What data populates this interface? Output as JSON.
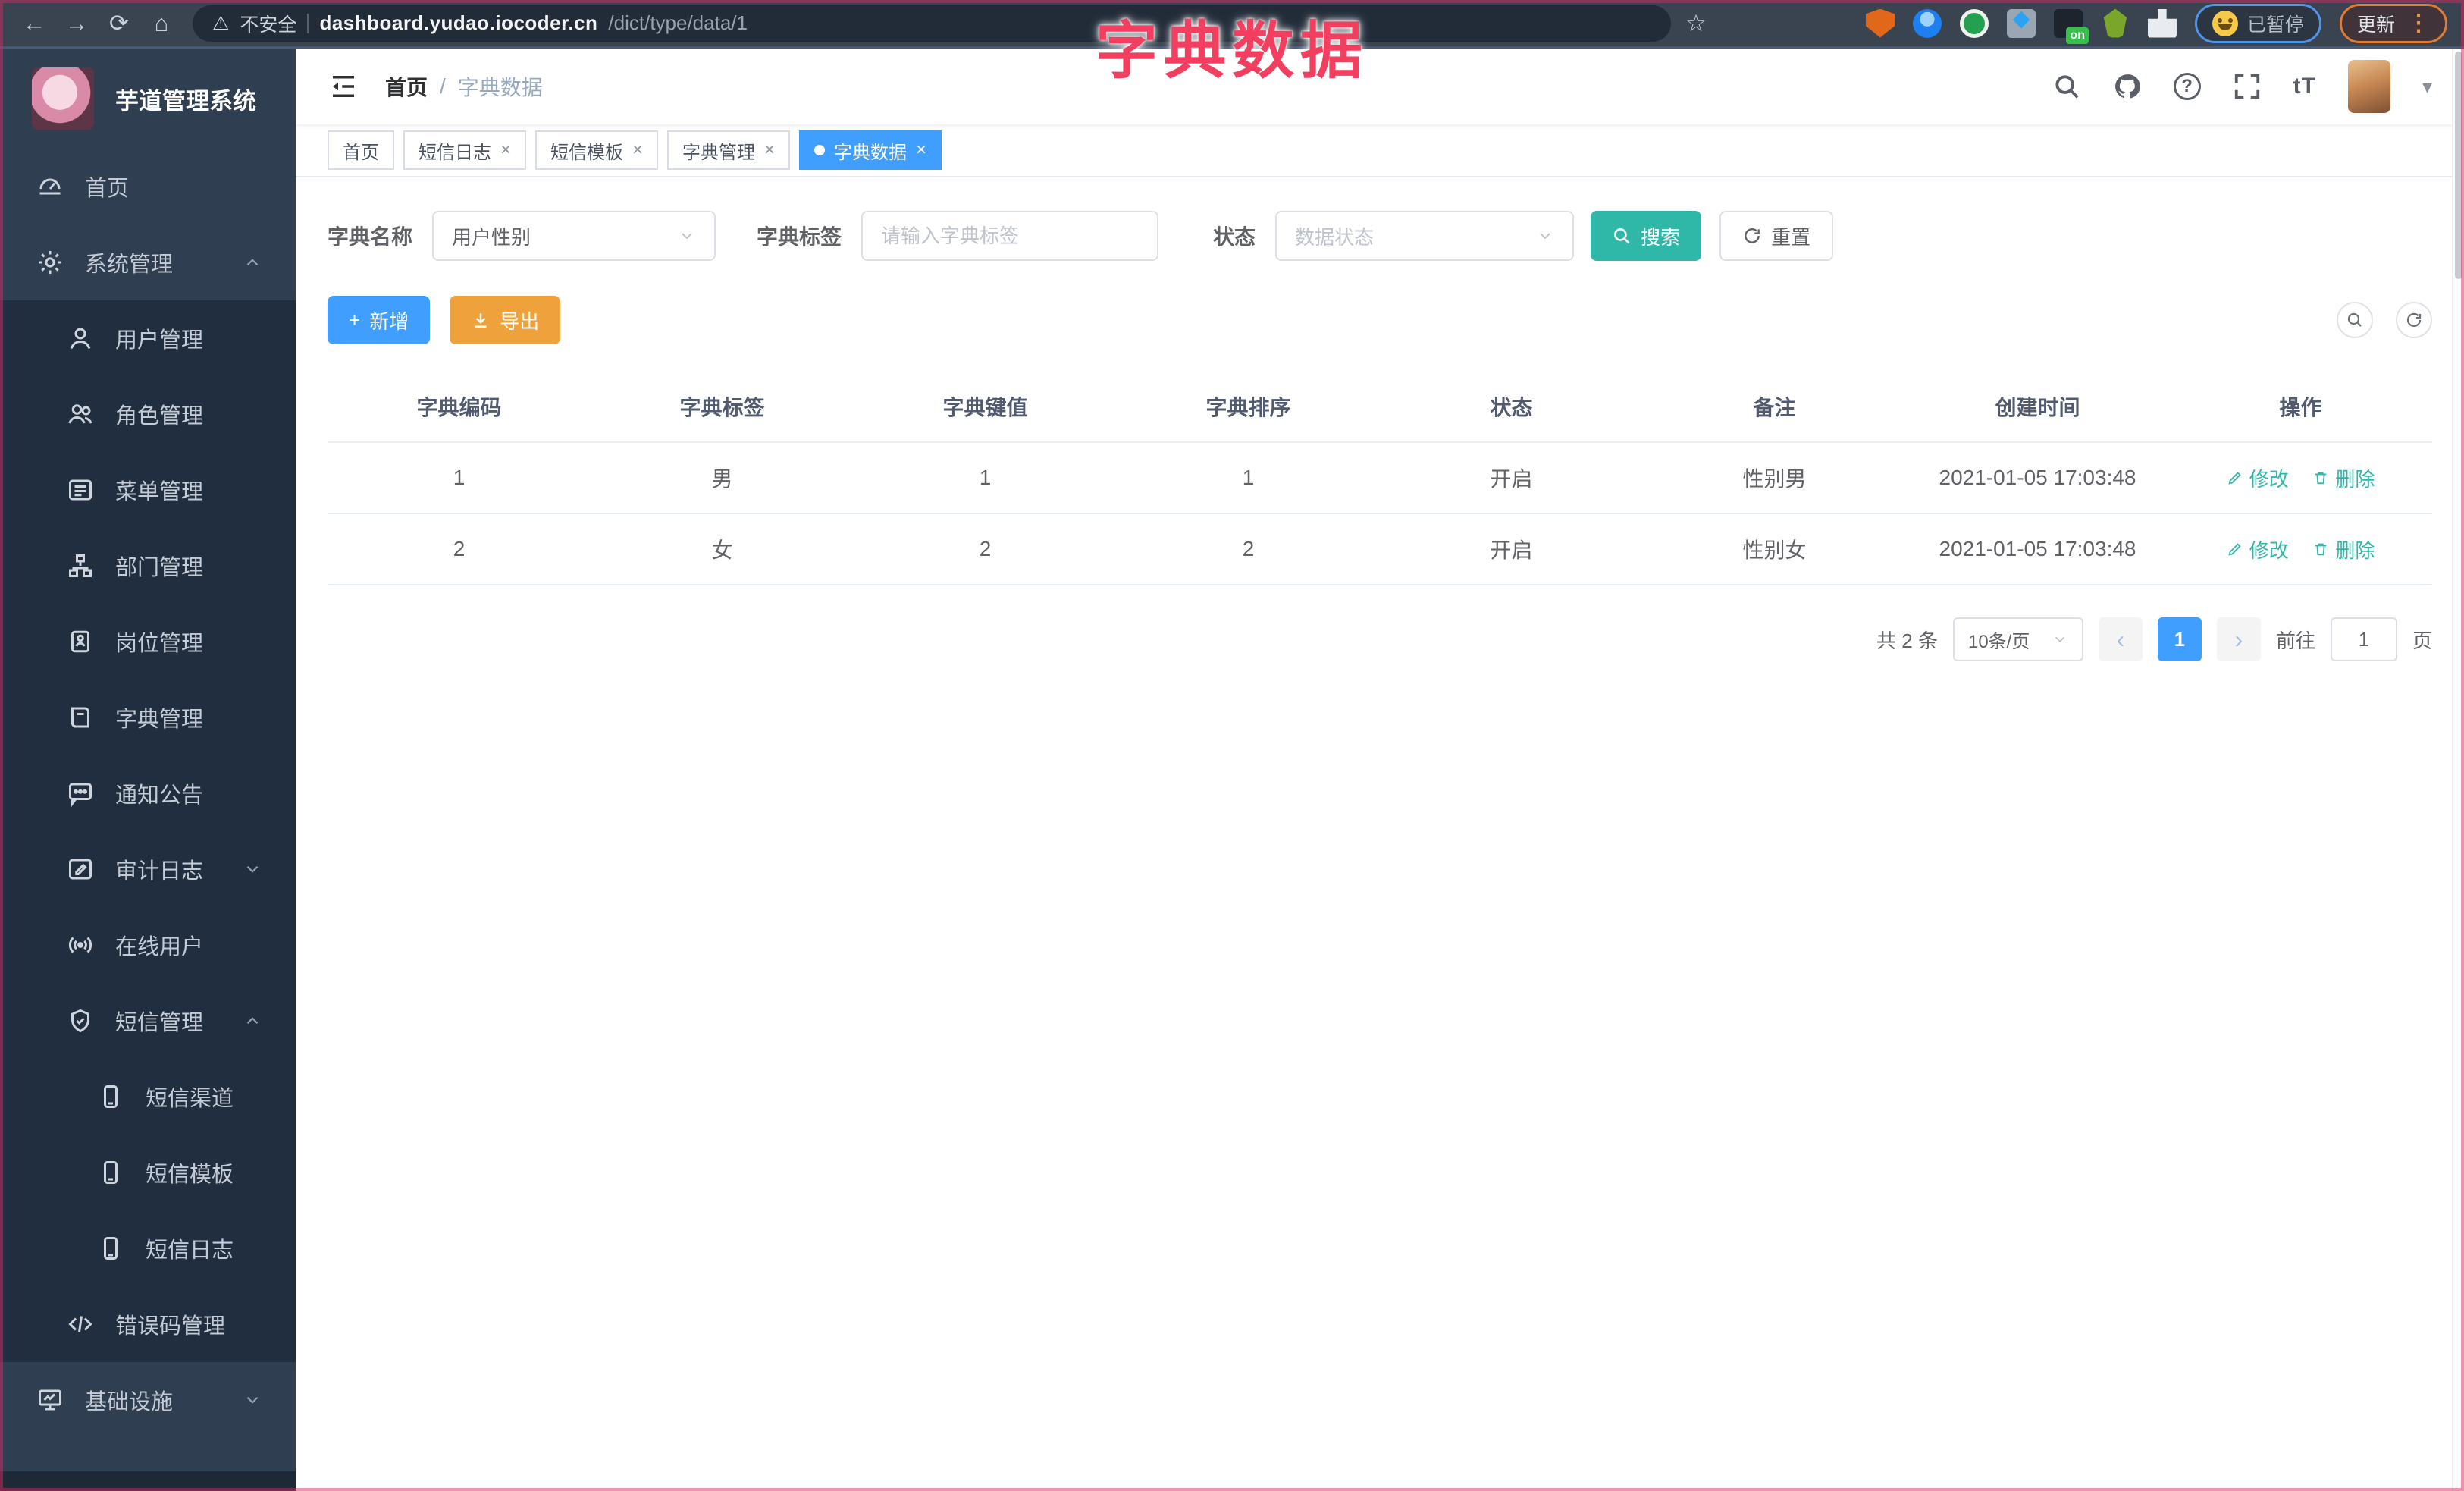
{
  "colors": {
    "primary": "#409eff",
    "teal": "#2fb8a8",
    "warning": "#efa23b",
    "overlay_pink": "#f23e5f",
    "sidebar_bg": "#2f3e50",
    "sidebar_sub_bg": "#212e3f"
  },
  "icons": {
    "back": "←",
    "forward": "→",
    "reload": "⟳",
    "home": "⌂",
    "warning": "⚠",
    "star": "☆",
    "kebab": "⋮",
    "close": "×",
    "prev": "‹",
    "next": "›",
    "question": "?",
    "font_size": "tT",
    "nav_caret": "▾",
    "on_badge": "on",
    "plus": "+"
  },
  "browser": {
    "security_label": "不安全",
    "url_domain": "dashboard.yudao.iocoder.cn",
    "url_path": "/dict/type/data/1",
    "paused_label": "已暂停",
    "update_label": "更新"
  },
  "overlay_title": "字典数据",
  "sidebar": {
    "logo_title": "芋道管理系统",
    "items": [
      {
        "label": "首页"
      },
      {
        "label": "系统管理"
      },
      {
        "label": "用户管理"
      },
      {
        "label": "角色管理"
      },
      {
        "label": "菜单管理"
      },
      {
        "label": "部门管理"
      },
      {
        "label": "岗位管理"
      },
      {
        "label": "字典管理"
      },
      {
        "label": "通知公告"
      },
      {
        "label": "审计日志"
      },
      {
        "label": "在线用户"
      },
      {
        "label": "短信管理"
      },
      {
        "label": "短信渠道"
      },
      {
        "label": "短信模板"
      },
      {
        "label": "短信日志"
      },
      {
        "label": "错误码管理"
      },
      {
        "label": "基础设施"
      }
    ]
  },
  "header": {
    "breadcrumb_home": "首页",
    "breadcrumb_sep": "/",
    "breadcrumb_current": "字典数据"
  },
  "tags": {
    "items": [
      {
        "label": "首页"
      },
      {
        "label": "短信日志"
      },
      {
        "label": "短信模板"
      },
      {
        "label": "字典管理"
      },
      {
        "label": "字典数据"
      }
    ]
  },
  "filters": {
    "name_label": "字典名称",
    "name_value": "用户性别",
    "tag_label": "字典标签",
    "tag_placeholder": "请输入字典标签",
    "status_label": "状态",
    "status_placeholder": "数据状态",
    "search_label": "搜索",
    "reset_label": "重置"
  },
  "toolbar": {
    "add_label": "新增",
    "export_label": "导出"
  },
  "table": {
    "headers": [
      "字典编码",
      "字典标签",
      "字典键值",
      "字典排序",
      "状态",
      "备注",
      "创建时间",
      "操作"
    ],
    "edit_label": "修改",
    "delete_label": "删除",
    "rows": [
      {
        "code": "1",
        "label": "男",
        "value": "1",
        "sort": "1",
        "status": "开启",
        "remark": "性别男",
        "created": "2021-01-05 17:03:48"
      },
      {
        "code": "2",
        "label": "女",
        "value": "2",
        "sort": "2",
        "status": "开启",
        "remark": "性别女",
        "created": "2021-01-05 17:03:48"
      }
    ]
  },
  "pagination": {
    "total": "共 2 条",
    "page_size": "10条/页",
    "current": "1",
    "goto_label": "前往",
    "goto_value": "1",
    "page_unit": "页"
  }
}
